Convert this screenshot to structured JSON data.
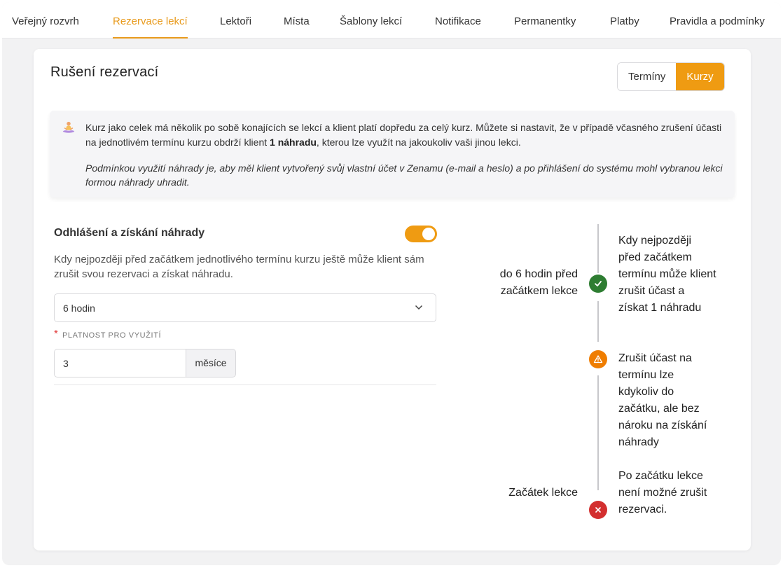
{
  "tabs": [
    {
      "label": "Veřejný rozvrh",
      "active": false
    },
    {
      "label": "Rezervace lekcí",
      "active": true
    },
    {
      "label": "Lektoři",
      "active": false
    },
    {
      "label": "Místa",
      "active": false
    },
    {
      "label": "Šablony lekcí",
      "active": false
    },
    {
      "label": "Notifikace",
      "active": false
    },
    {
      "label": "Permanentky",
      "active": false
    },
    {
      "label": "Platby",
      "active": false
    },
    {
      "label": "Pravidla a podmínky",
      "active": false
    }
  ],
  "card": {
    "title": "Rušení rezervací",
    "segmented": {
      "options": [
        "Termíny",
        "Kurzy"
      ],
      "selected": "Kurzy"
    }
  },
  "info": {
    "icon": "meditation-icon",
    "p1_before": "Kurz jako celek má několik po sobě konajících se lekcí a klient platí dopředu za celý kurz. Můžete si nastavit, že v případě včasného zrušení účasti na jednotlivém termínu kurzu obdrží klient ",
    "p1_bold": "1 náhradu",
    "p1_after": ", kterou lze využít na jakoukoliv vaši jinou lekci.",
    "p2": "Podmínkou využití náhrady je, aby měl klient vytvořený svůj vlastní účet v Zenamu (e-mail a heslo) a po přihlášení do systému mohl vybranou lekci formou náhrady uhradit."
  },
  "refund": {
    "title": "Odhlášení a získání náhrady",
    "toggle_on": true,
    "description": "Kdy nejpozději před začátkem jednotlivého termínu kurzu ještě může klient sám zrušit svou rezervaci a získat náhradu.",
    "select_value": "6 hodin",
    "required_mark": "*",
    "validity_label": "PLATNOST PRO VYUŽITÍ",
    "validity_value": "3",
    "validity_unit": "měsíce"
  },
  "timeline": {
    "step1_left_line1": "do 6 hodin před",
    "step1_left_line2": "začátkem lekce",
    "step1_right": "Kdy nejpozději před začátkem termínu může klient zrušit účast a získat 1 náhradu",
    "step2_right": "Zrušit účast na termínu lze kdykoliv do začátku, ale bez nároku na získání náhrady",
    "step3_left": "Začátek lekce",
    "step3_right": "Po začátku lekce není možné zrušit rezervaci.",
    "colors": {
      "ok": "#2e7d32",
      "warn": "#ef7d00",
      "stop": "#d32f2f",
      "line": "#c7c7cb"
    }
  },
  "colors": {
    "accent": "#ef9b12",
    "tab_active": "#e89a1c"
  }
}
